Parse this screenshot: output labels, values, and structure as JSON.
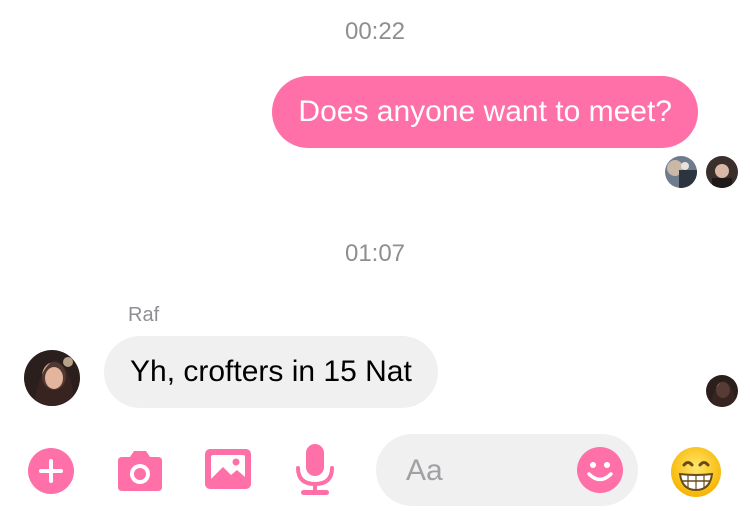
{
  "messages": [
    {
      "timestamp": "00:22",
      "text": "Does anyone want to meet?",
      "direction": "outgoing"
    },
    {
      "timestamp": "01:07",
      "sender": "Raf",
      "text": "Yh, crofters in 15 Nat",
      "direction": "incoming"
    }
  ],
  "composer": {
    "placeholder": "Aa"
  },
  "toolbar": {
    "icons": [
      "plus-icon",
      "camera-icon",
      "gallery-icon",
      "microphone-icon",
      "smiley-icon",
      "grinning-emoji-icon"
    ]
  },
  "colors": {
    "accent": "#ff6fa8",
    "incoming_bubble": "#f0f0f0",
    "timestamp_text": "#8e8e93"
  }
}
